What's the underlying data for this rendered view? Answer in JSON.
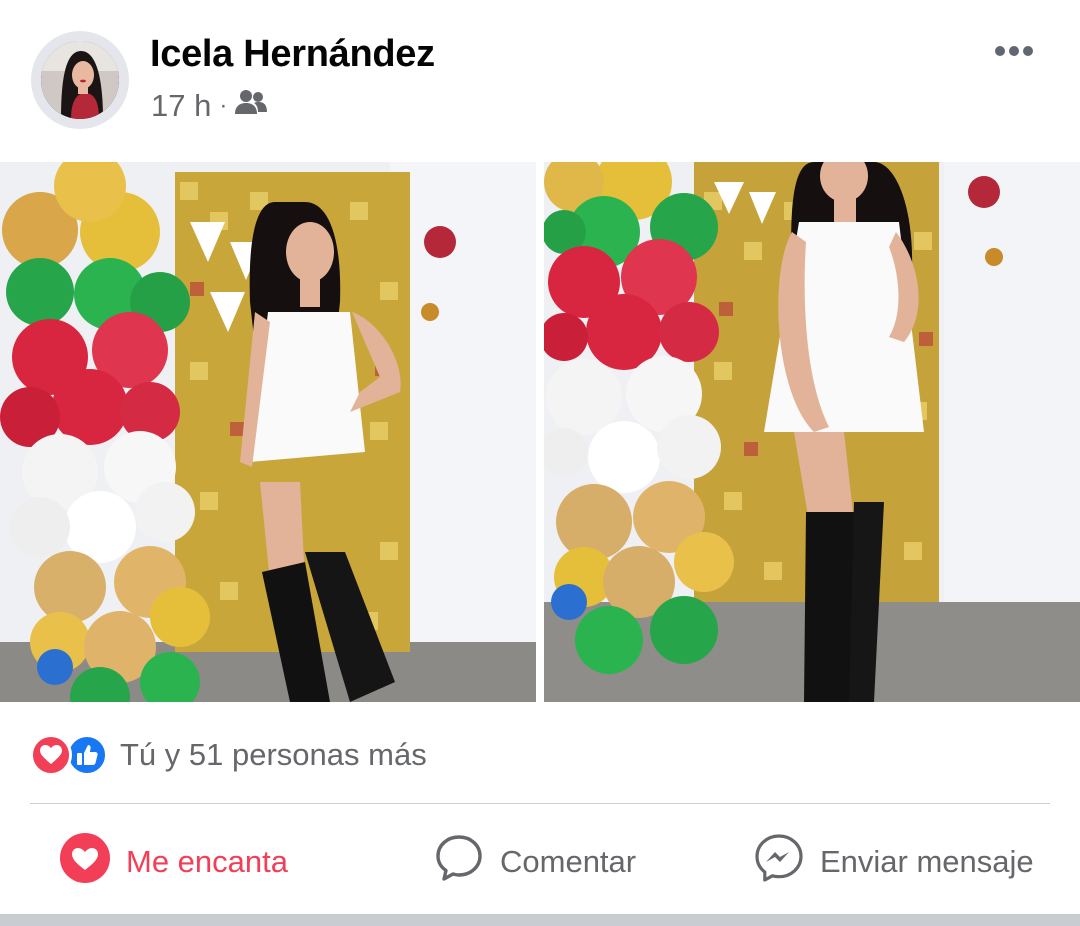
{
  "post": {
    "author": "Icela Hernández",
    "time": "17 h",
    "separator": "·",
    "audience_icon": "friends-icon",
    "more_icon": "more-horizontal-icon"
  },
  "photos": [
    {
      "name": "photo-left",
      "description_icon": "image-icon"
    },
    {
      "name": "photo-right",
      "description_icon": "image-icon"
    }
  ],
  "reactions": {
    "icons": [
      "love-reaction-icon",
      "like-reaction-icon"
    ],
    "summary": "Tú y 51 personas más"
  },
  "actions": {
    "love_label": "Me encanta",
    "comment_label": "Comentar",
    "send_label": "Enviar mensaje"
  },
  "colors": {
    "love": "#f33e58",
    "like": "#1877f2",
    "secondary_text": "#65676b"
  }
}
